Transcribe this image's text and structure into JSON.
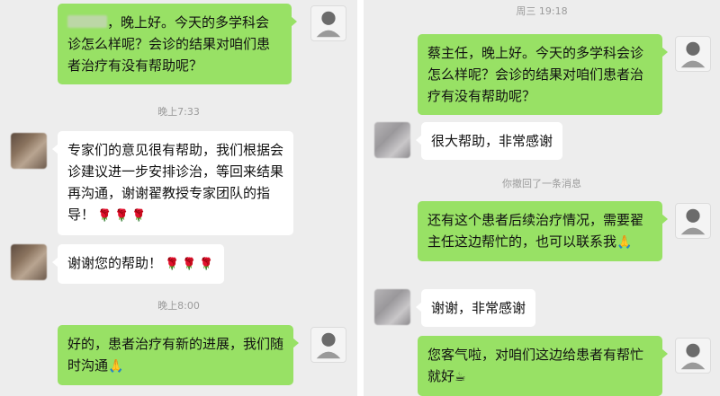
{
  "left": {
    "msg1_text": "，晚上好。今天的多学科会诊怎么样呢？会诊的结果对咱们患者治疗有没有帮助呢？",
    "time1": "晚上7:33",
    "msg2_text": "专家们的意见很有帮助，我们根据会诊建议进一步安排诊治，等回来结果再沟通，谢谢翟教授专家团队的指导！",
    "msg3_text": "谢谢您的帮助！",
    "time2": "晚上8:00",
    "msg4_text": "好的，患者治疗有新的进展，我们随时沟通",
    "rose": "🌹"
  },
  "right": {
    "time_top": "周三 19:18",
    "msg1_text": "蔡主任，晚上好。今天的多学科会诊怎么样呢？会诊的结果对咱们患者治疗有没有帮助呢？",
    "msg2_text": "很大帮助，非常感谢",
    "recall_notice": "你撤回了一条消息",
    "msg3_text": "还有这个患者后续治疗情况，需要翟主任这边帮忙的，也可以联系我",
    "msg4_text": "谢谢，非常感谢",
    "msg5_text": "您客气啦，对咱们这边给患者有帮忙就好"
  },
  "icons": {
    "pray": "🙏",
    "coffee": "☕"
  },
  "colors": {
    "chat_bg": "#ededed",
    "sent_bubble": "#98e165",
    "received_bubble": "#ffffff",
    "timestamp": "#9b9b9b"
  }
}
